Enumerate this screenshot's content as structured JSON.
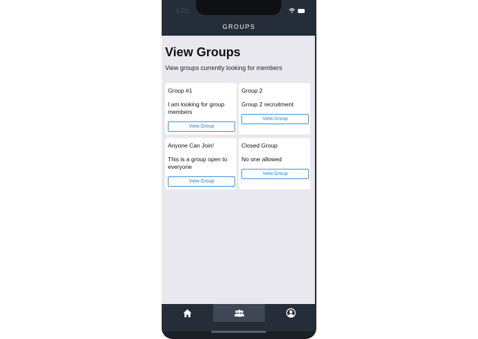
{
  "status_bar": {
    "time": "4:20"
  },
  "nav": {
    "title": "GROUPS"
  },
  "page": {
    "title": "View Groups",
    "subtitle": "View groups currently looking for members"
  },
  "groups": [
    {
      "name": "Group #1",
      "description": "I am looking for group members",
      "button_label": "View Group"
    },
    {
      "name": "Group 2",
      "description": "Group 2 recruitment",
      "button_label": "View Group"
    },
    {
      "name": "Anyone Can Join!",
      "description": "This is a group open to everyone",
      "button_label": "View Group"
    },
    {
      "name": "Closed Group",
      "description": "No one allowed",
      "button_label": "View Group"
    }
  ],
  "tabs": [
    {
      "icon": "home-icon",
      "active": false
    },
    {
      "icon": "group-icon",
      "active": true
    },
    {
      "icon": "profile-icon",
      "active": false
    }
  ],
  "colors": {
    "bar_background": "#252d38",
    "screen_background": "#e9e8ee",
    "accent": "#3a8fd6"
  }
}
